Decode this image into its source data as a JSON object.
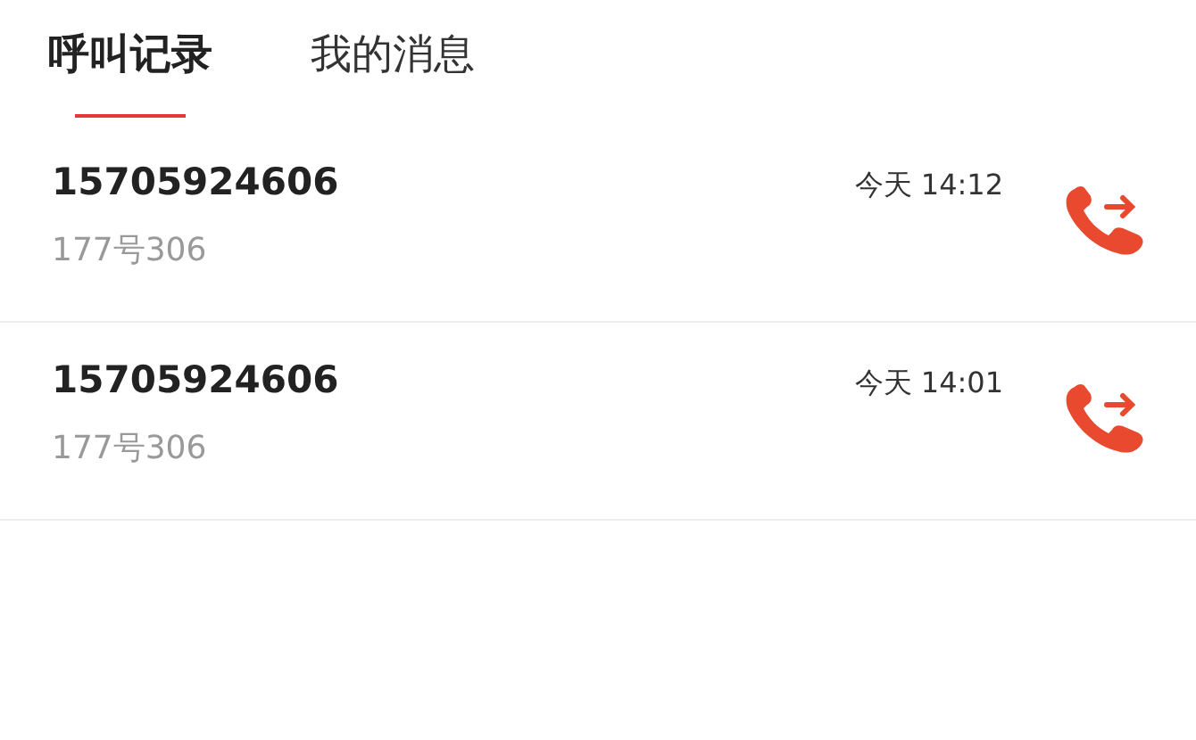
{
  "tabs": [
    {
      "label": "呼叫记录",
      "selected": true
    },
    {
      "label": "我的消息",
      "selected": false
    }
  ],
  "calls": [
    {
      "number": "15705924606",
      "name": "177号306",
      "time": "今天 14:12"
    },
    {
      "number": "15705924606",
      "name": "177号306",
      "time": "今天 14:01"
    }
  ]
}
